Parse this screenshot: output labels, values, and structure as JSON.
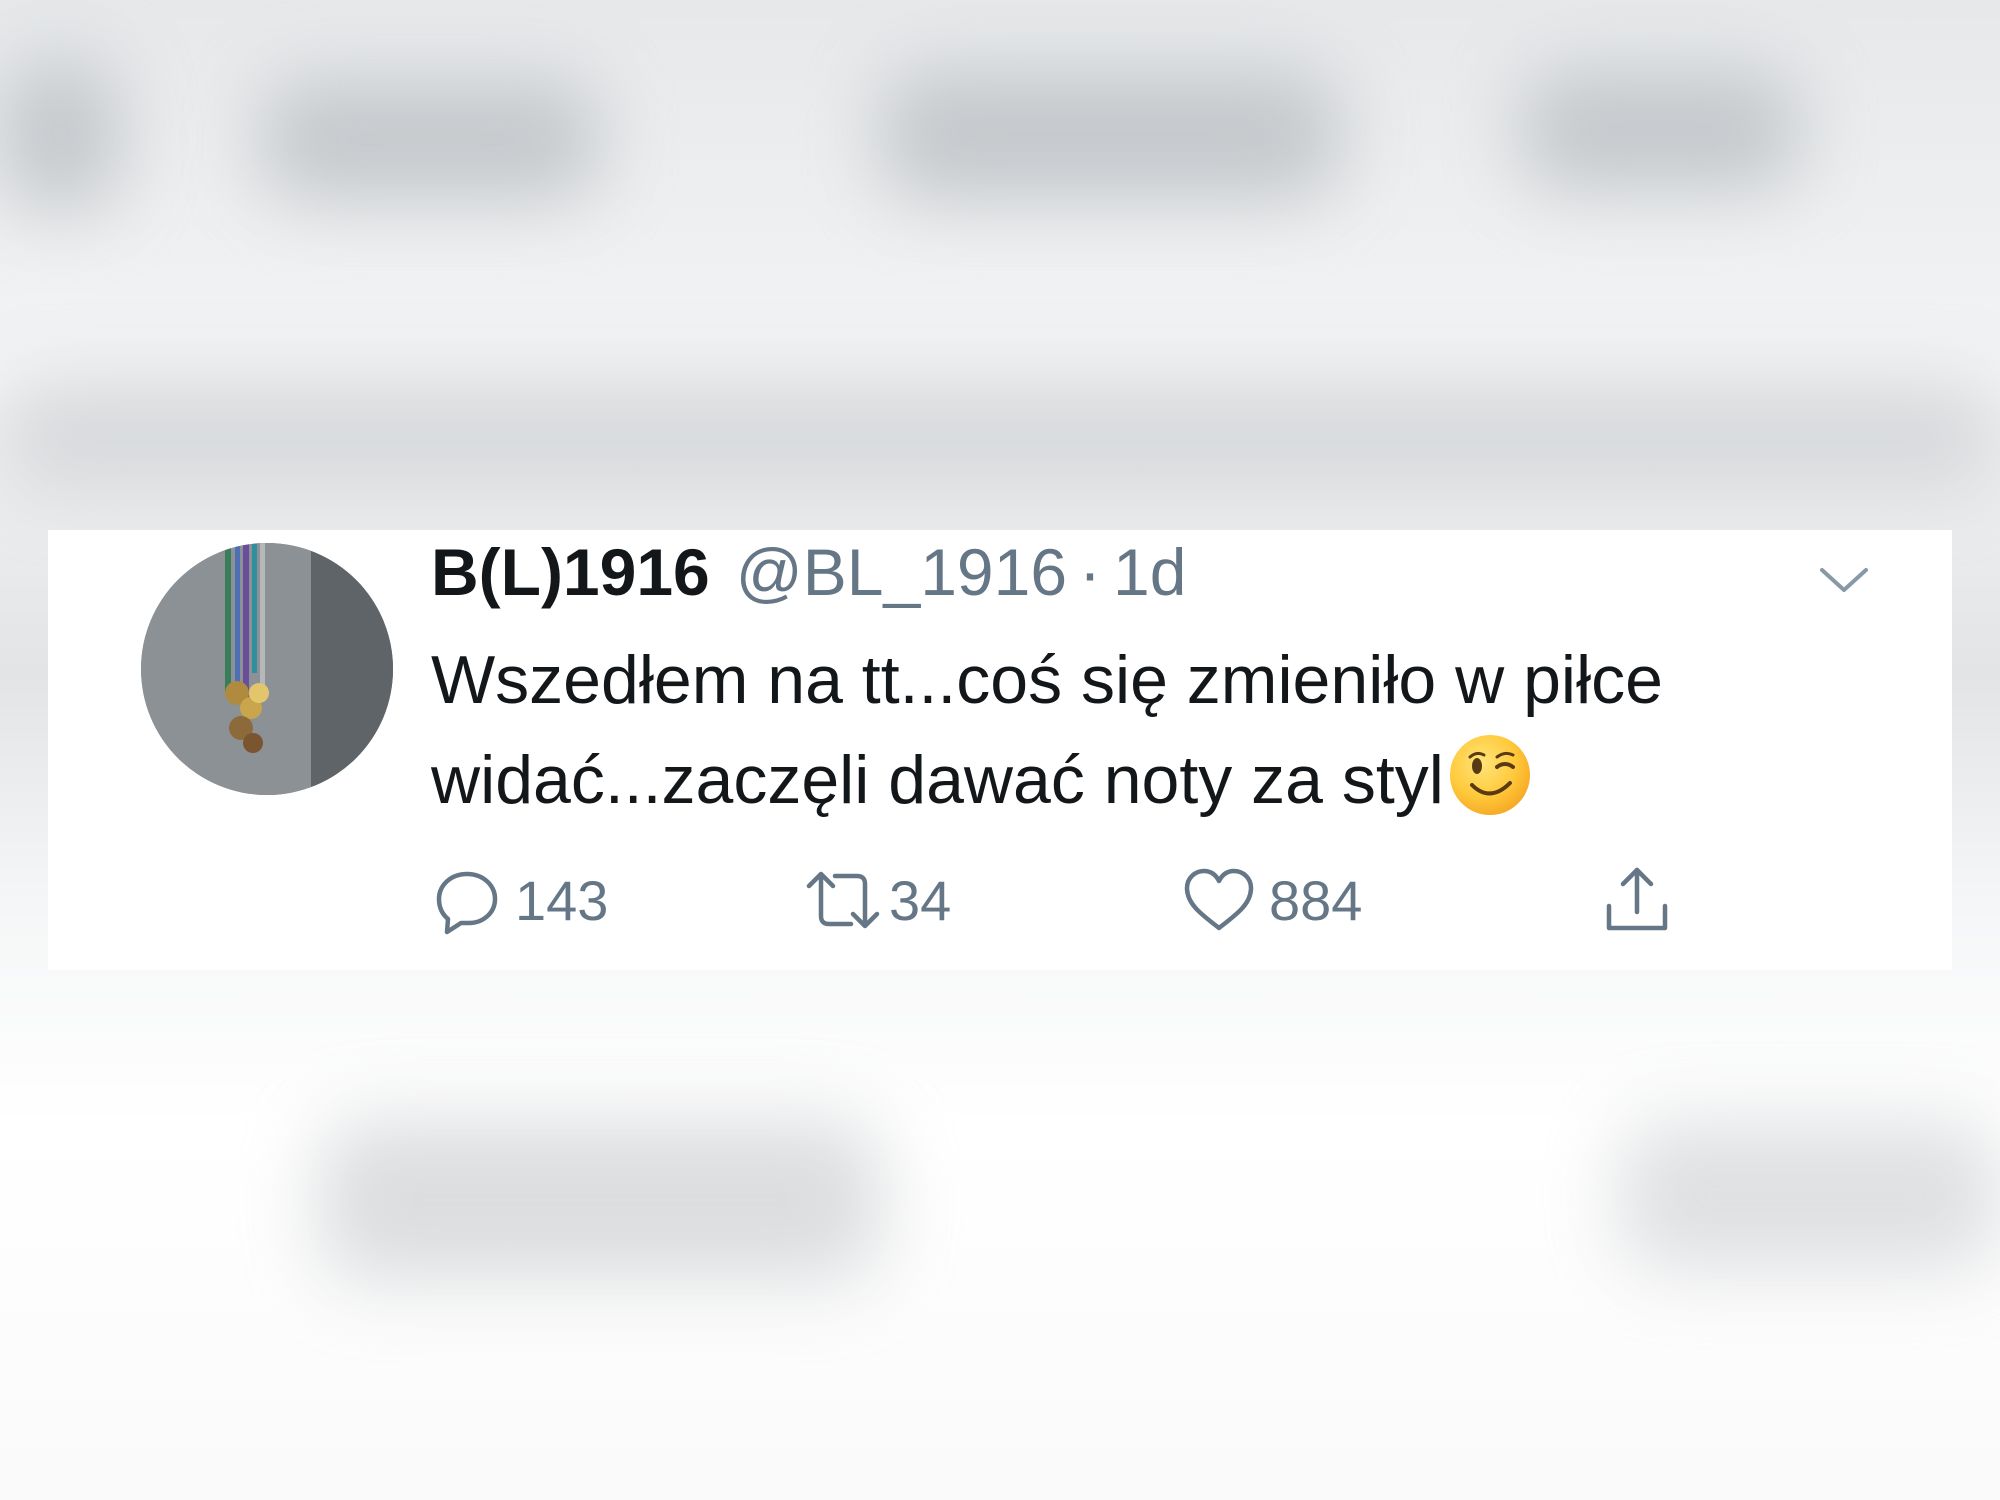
{
  "tweet": {
    "display_name": "B(L)1916",
    "handle": "@BL_1916",
    "separator": "·",
    "time": "1d",
    "text_line1": "Wszedłem na tt...coś się zmieniło w piłce",
    "text_line2": "widać...zaczęli dawać noty za styl",
    "emoji": "winking-face"
  },
  "actions": {
    "reply_count": "143",
    "retweet_count": "34",
    "like_count": "884"
  },
  "colors": {
    "text": "#14171a",
    "secondary": "#657786",
    "card_background": "#ffffff"
  },
  "icons": [
    "chevron-down-icon",
    "reply-icon",
    "retweet-icon",
    "like-icon",
    "share-icon",
    "wink-emoji-icon"
  ]
}
